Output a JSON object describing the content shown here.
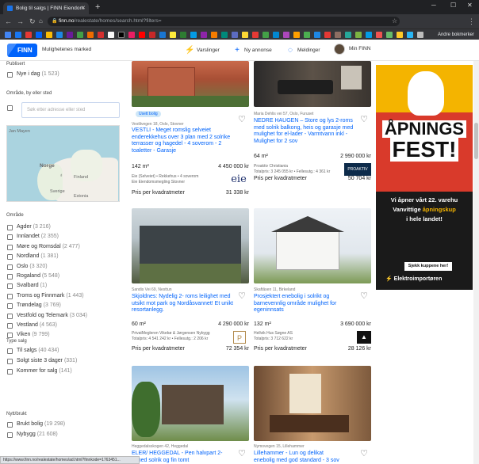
{
  "browser": {
    "tab_title": "Bolig til salgs | FINN Eiendom",
    "url_host": "finn.no",
    "url_path": "/realestate/homes/search.html?filters=",
    "other_bookmarks": "Andre bokmerker",
    "status_url": "https://www.finn.no/realestate/homes/ad.html?finnkode=1763451..."
  },
  "header": {
    "logo": "FINN",
    "market": "Mulighetenes marked",
    "nav": [
      {
        "label": "Varslinger"
      },
      {
        "label": "Ny annonse"
      },
      {
        "label": "Meldinger"
      },
      {
        "label": "Min FINN"
      }
    ]
  },
  "sidebar": {
    "published_heading": "Publisert",
    "published_option": {
      "label": "Nye i dag",
      "count": "(1 523)"
    },
    "area_heading": "Område, by eller sted",
    "search_placeholder": "Søk etter adresse eller sted",
    "map_labels": {
      "sea": "Jan Mayen",
      "norway": "Norge",
      "finland": "Finland",
      "sweden": "Sverige",
      "estonia": "Estonia"
    },
    "region_heading": "Område",
    "regions": [
      {
        "label": "Agder",
        "count": "(3 216)"
      },
      {
        "label": "Innlandet",
        "count": "(2 355)"
      },
      {
        "label": "Møre og Romsdal",
        "count": "(2 477)"
      },
      {
        "label": "Nordland",
        "count": "(1 381)"
      },
      {
        "label": "Oslo",
        "count": "(3 320)"
      },
      {
        "label": "Rogaland",
        "count": "(5 548)"
      },
      {
        "label": "Svalbard",
        "count": "(1)"
      },
      {
        "label": "Troms og Finnmark",
        "count": "(1 443)"
      },
      {
        "label": "Trøndelag",
        "count": "(3 769)"
      },
      {
        "label": "Vestfold og Telemark",
        "count": "(3 034)"
      },
      {
        "label": "Vestland",
        "count": "(4 563)"
      },
      {
        "label": "Viken",
        "count": "(9 799)"
      }
    ],
    "sale_type_heading": "Type salg",
    "sale_types": [
      {
        "label": "Til salgs",
        "count": "(40 434)"
      },
      {
        "label": "Solgt siste 3 dager",
        "count": "(331)"
      },
      {
        "label": "Kommer for salg",
        "count": "(141)"
      }
    ],
    "new_used_heading": "Nytt/brukt",
    "new_used": [
      {
        "label": "Brukt bolig",
        "count": "(19 298)"
      },
      {
        "label": "Nybygg",
        "count": "(21 608)"
      }
    ]
  },
  "listings": [
    {
      "badge": "Usett bolig",
      "location": "Vestlivegen 18, Oslo, Stovner",
      "title": "VESTLI - Meget romslig selveiet enderekkehus over 3 plan med 2 solrike terrasser og hagedel - 4 soverom - 2 toaletter - Garasje",
      "size": "142 m²",
      "price": "4 450 000 kr",
      "agent_line1": "Eie (Selveiet) • Rekkehus • 4 soverom",
      "agent_line2": "Eie Eiendomsmegling Stovner",
      "ppm_label": "Pris per kvadratmeter",
      "ppm_value": "31 338 kr",
      "agent_logo": "eie"
    },
    {
      "badge": "",
      "location": "Maria Dehlis vei 57, Oslo, Furuset",
      "title": "NEDRE HAUGEN – Store og lys 2-roms med solrik balkong, heis og garasje med mulighet for el-lader - Varmtvann inkl - Mulighet for 2 sov",
      "size": "64 m²",
      "price": "2 990 000 kr",
      "agent_line1": "Proaktiv Christiania",
      "agent_line2": "Totalpris: 3 245 055 kr • Fellesutg.: 4 361 kr",
      "ppm_label": "Pris per kvadratmeter",
      "ppm_value": "50 704 kr",
      "agent_logo": "PROAKTIV"
    },
    {
      "badge": "",
      "location": "Sandis Vei 69, Nesttun",
      "title": "Skjoldnes: Nydelig 2- roms leilighet med utsikt mot park og Nordåsvannet! Et unikt resortanlegg.",
      "size": "60 m²",
      "price": "4 290 000 kr",
      "agent_line1": "PrivatMegleren Vikebø & Jørgensen Nybygg",
      "agent_line2": "Totalpris: 4 541 242 kr • Fellesutg.: 2 206 kr",
      "ppm_label": "Pris per kvadratmeter",
      "ppm_value": "72 354 kr",
      "agent_logo": "P"
    },
    {
      "badge": "",
      "location": "Skaftåsen 11, Birkeland",
      "title": "Prosjektert enebolig i solrikt og barnevennlig område mulighet for egeninnsats",
      "size": "132 m²",
      "price": "3 690 000 kr",
      "agent_line1": "Hellvik Hus Søgne AS",
      "agent_line2": "Totalpris: 3 712 622 kr",
      "ppm_label": "Pris per kvadratmeter",
      "ppm_value": "28 126 kr",
      "agent_logo": "▲"
    },
    {
      "badge": "",
      "location": "Heggedalsskogen 42, Heggedal",
      "title": "ELER/ HEGGEDAL - Pen halvpart 2-",
      "title_line2": "e med solrik og fin tomt",
      "size": "",
      "price": "",
      "agent_line1": "",
      "agent_line2": "",
      "ppm_label": "",
      "ppm_value": "",
      "agent_logo": ""
    },
    {
      "badge": "",
      "location": "Nymovegen 15, Lillehammer",
      "title": "Lillehammer - Lun og delikat",
      "title_line2": "enebolig med god standard - 3 sov",
      "size": "",
      "price": "",
      "agent_line1": "",
      "agent_line2": "",
      "ppm_label": "",
      "ppm_value": "",
      "agent_logo": ""
    }
  ],
  "ad": {
    "headline1": "ÅPNINGS",
    "headline2": "FEST!",
    "line1": "Vi åpner vårt 22. varehu",
    "line2a": "Vanvittige ",
    "line2b": "åpningskup",
    "line3": "i hele landet!",
    "button": "Sjekk kuppene her!",
    "brand": "Elektroimportøren"
  },
  "colors": {
    "finn_blue": "#0063fb",
    "link_blue": "#0063fb",
    "ad_red": "#d93a2b",
    "ad_yellow": "#f4b400"
  }
}
